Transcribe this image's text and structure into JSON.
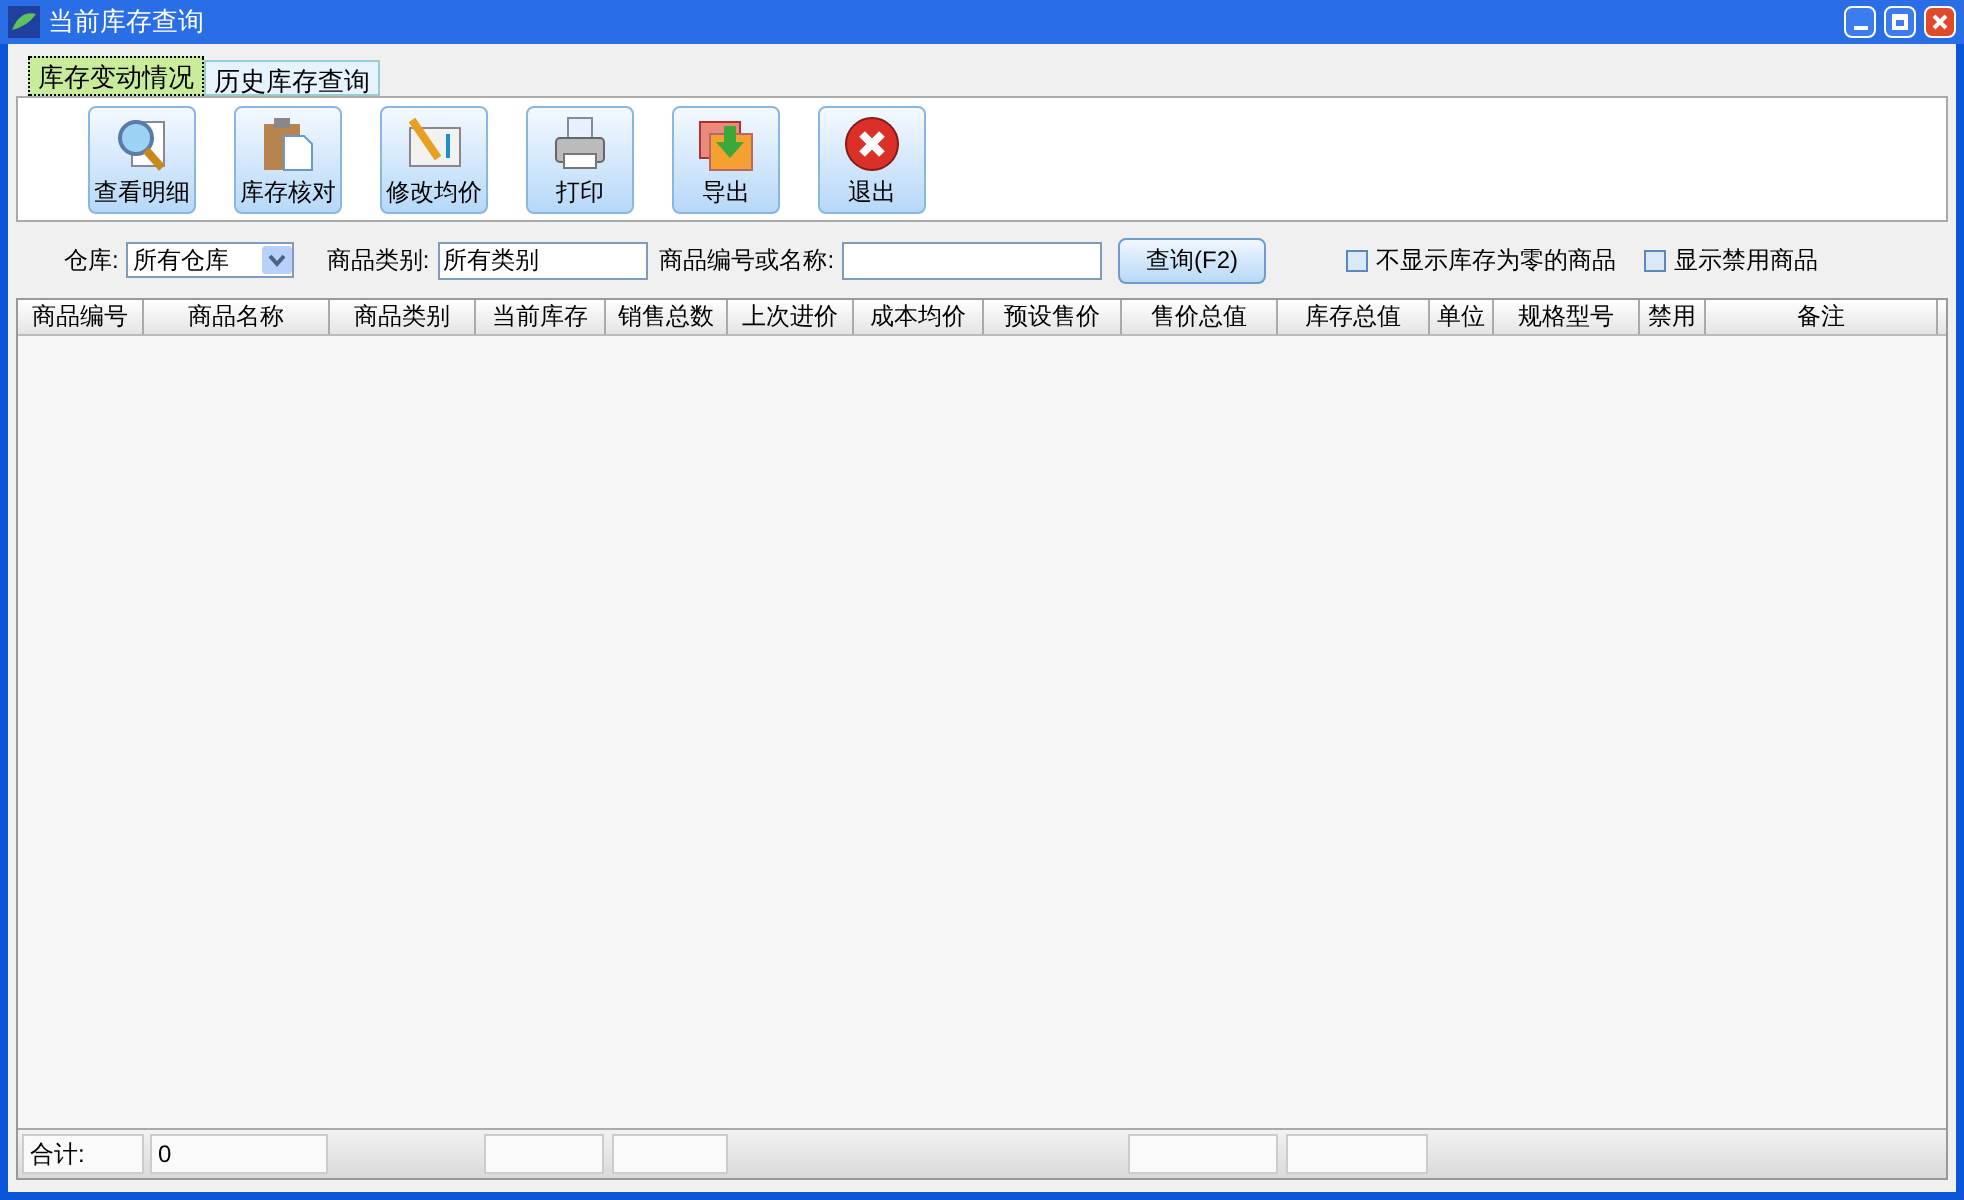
{
  "window": {
    "title": "当前库存查询"
  },
  "tabs": [
    {
      "label": "库存变动情况",
      "selected": true
    },
    {
      "label": "历史库存查询",
      "selected": false
    }
  ],
  "toolbar": [
    {
      "label": "查看明细",
      "kind": "detail"
    },
    {
      "label": "库存核对",
      "kind": "check"
    },
    {
      "label": "修改均价",
      "kind": "price"
    },
    {
      "label": "打印",
      "kind": "print"
    },
    {
      "label": "导出",
      "kind": "export"
    },
    {
      "label": "退出",
      "kind": "exit"
    }
  ],
  "filters": {
    "warehouse_label": "仓库:",
    "warehouse_value": "所有仓库",
    "category_label": "商品类别:",
    "category_value": "所有类别",
    "code_label": "商品编号或名称:",
    "query_button": "查询(F2)",
    "options": [
      {
        "label": "不显示库存为零的商品",
        "checked": false
      },
      {
        "label": "显示禁用商品",
        "checked": false
      }
    ]
  },
  "table": {
    "columns": [
      "商品编号",
      "商品名称",
      "商品类别",
      "当前库存",
      "销售总数",
      "上次进价",
      "成本均价",
      "预设售价",
      "售价总值",
      "库存总值",
      "单位",
      "规格型号",
      "禁用",
      "备注"
    ]
  },
  "footer": {
    "label": "合计:",
    "count": "0"
  }
}
